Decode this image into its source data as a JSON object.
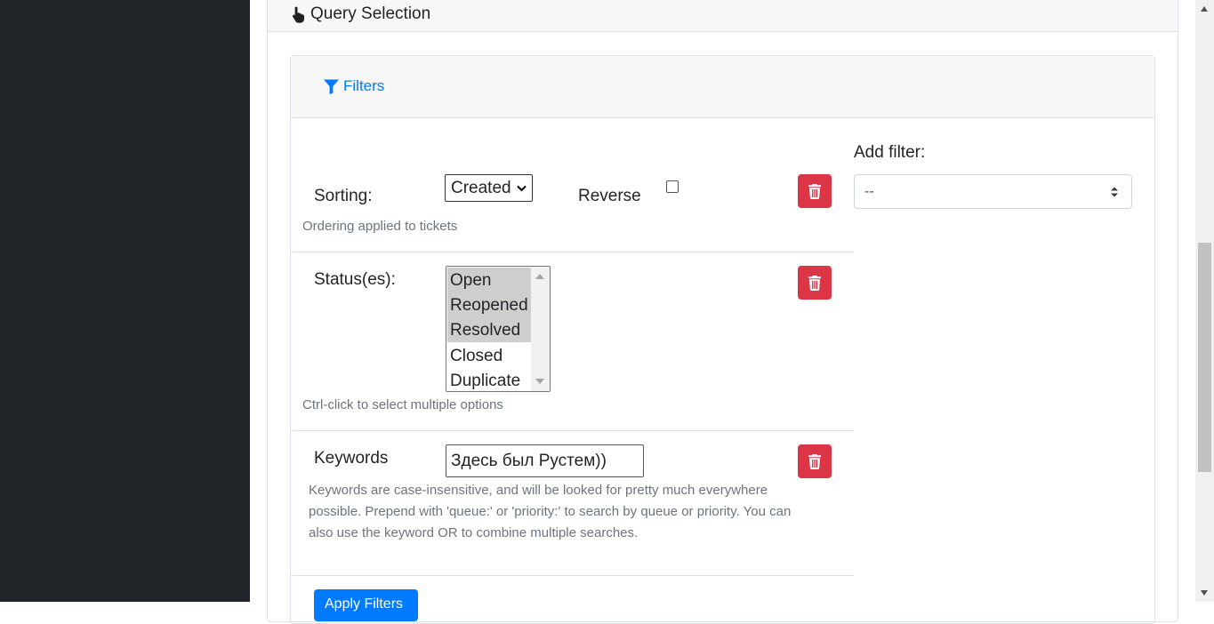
{
  "header": {
    "title": "Query Selection"
  },
  "filters": {
    "toggle_label": "Filters",
    "add_filter": {
      "label": "Add filter:",
      "value": "--"
    },
    "sorting": {
      "label": "Sorting:",
      "selected": "Created",
      "reverse_label": "Reverse",
      "reverse_checked": false,
      "help": "Ordering applied to tickets"
    },
    "status": {
      "label": "Status(es):",
      "options": [
        {
          "label": "Open",
          "selected": true
        },
        {
          "label": "Reopened",
          "selected": true
        },
        {
          "label": "Resolved",
          "selected": true
        },
        {
          "label": "Closed",
          "selected": false
        },
        {
          "label": "Duplicate",
          "selected": false
        }
      ],
      "help": "Ctrl-click to select multiple options"
    },
    "keywords": {
      "label": "Keywords",
      "value": "Здесь был Рустем))",
      "help_line1": "Keywords are case-insensitive, and will be looked for pretty much everywhere",
      "help_line2": "possible. Prepend with 'queue:' or 'priority:' to search by queue or priority. You can",
      "help_line3": "also use the keyword OR to combine multiple searches."
    },
    "apply_label": "Apply Filters"
  },
  "colors": {
    "accent": "#007bff",
    "danger": "#dc3545",
    "sidebar": "#212529"
  }
}
